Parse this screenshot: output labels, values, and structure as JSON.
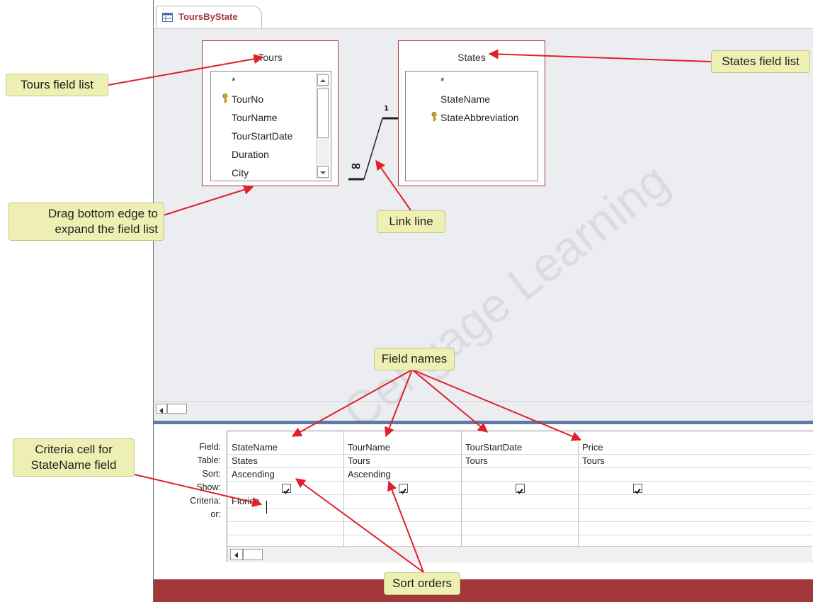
{
  "document_tab": {
    "label": "ToursByState"
  },
  "tables": {
    "tours": {
      "title": "Tours",
      "fields": [
        "*",
        "TourNo",
        "TourName",
        "TourStartDate",
        "Duration",
        "City"
      ],
      "key_field": "TourNo"
    },
    "states": {
      "title": "States",
      "fields": [
        "*",
        "StateName",
        "StateAbbreviation"
      ],
      "key_field": "StateAbbreviation"
    }
  },
  "relationship": {
    "one_side": "1",
    "many_side": "∞"
  },
  "grid": {
    "row_labels": [
      "Field:",
      "Table:",
      "Sort:",
      "Show:",
      "Criteria:",
      "or:"
    ],
    "columns": [
      {
        "field": "StateName",
        "table": "States",
        "sort": "Ascending",
        "show": true,
        "criteria": "Florida"
      },
      {
        "field": "TourName",
        "table": "Tours",
        "sort": "Ascending",
        "show": true,
        "criteria": ""
      },
      {
        "field": "TourStartDate",
        "table": "Tours",
        "sort": "",
        "show": true,
        "criteria": ""
      },
      {
        "field": "Price",
        "table": "Tours",
        "sort": "",
        "show": true,
        "criteria": ""
      }
    ]
  },
  "callouts": {
    "tours_field_list": "Tours field list",
    "states_field_list": "States field list",
    "drag_bottom_edge": "Drag bottom edge to expand the field list",
    "link_line": "Link line",
    "field_names": "Field names",
    "criteria_cell": "Criteria cell for StateName field",
    "sort_orders": "Sort orders"
  },
  "watermark": "Cengage Learning",
  "colors": {
    "accent": "#a4373a",
    "callout_fill": "#eef0b3",
    "arrow": "#e0202a",
    "splitter": "#5d7aa8"
  }
}
